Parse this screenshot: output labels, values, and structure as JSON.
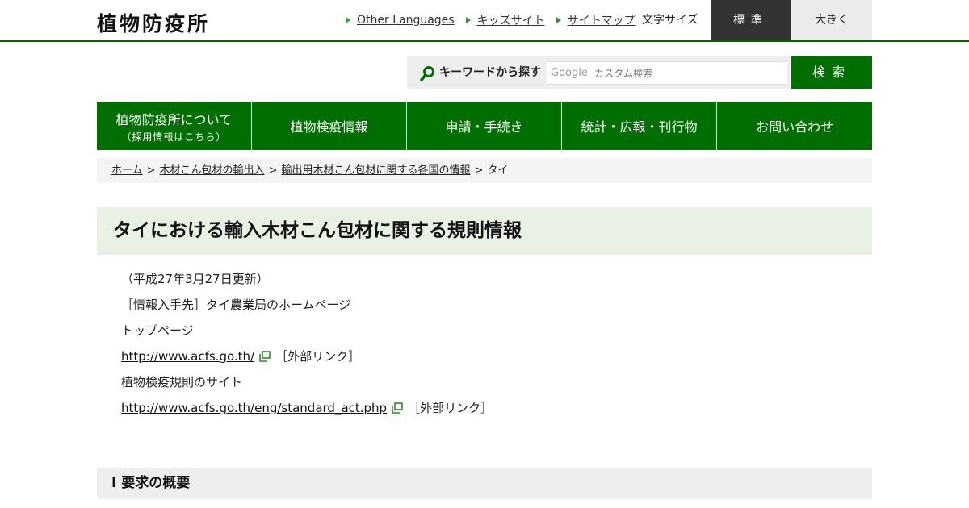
{
  "header": {
    "site_title": "植物防疫所",
    "util_links": [
      "Other Languages",
      "キッズサイト",
      "サイトマップ"
    ],
    "font_size_label": "文字サイズ",
    "size_standard": "標準",
    "size_large": "大きく"
  },
  "search": {
    "label": "キーワードから探す",
    "google_mark": "Google",
    "placeholder": "カスタム検索",
    "button_label": "検索"
  },
  "nav": {
    "items": [
      {
        "label": "植物防疫所について",
        "sub": "（採用情報はこちら）"
      },
      {
        "label": "植物検疫情報",
        "sub": ""
      },
      {
        "label": "申請・手続き",
        "sub": ""
      },
      {
        "label": "統計・広報・刊行物",
        "sub": ""
      },
      {
        "label": "お問い合わせ",
        "sub": ""
      }
    ]
  },
  "breadcrumb": {
    "items": [
      "ホーム",
      "木材こん包材の輸出入",
      "輸出用木材こん包材に関する各国の情報"
    ],
    "current": "タイ",
    "separator": ">"
  },
  "main": {
    "title": "タイにおける輸入木材こん包材に関する規則情報",
    "updated": "（平成27年3月27日更新）",
    "source": "［情報入手先］タイ農業局のホームページ",
    "top_page_label": "トップページ",
    "top_page_url": "http://www.acfs.go.th/",
    "external_note": "［外部リンク］",
    "regulation_label": "植物検疫規則のサイト",
    "regulation_url": "http://www.acfs.go.th/eng/standard_act.php"
  },
  "section": {
    "title": "Ⅰ 要求の概要"
  },
  "colors": {
    "brand_green": "#006e00",
    "title_bg": "#e8f1e4",
    "dark_button": "#333333"
  }
}
